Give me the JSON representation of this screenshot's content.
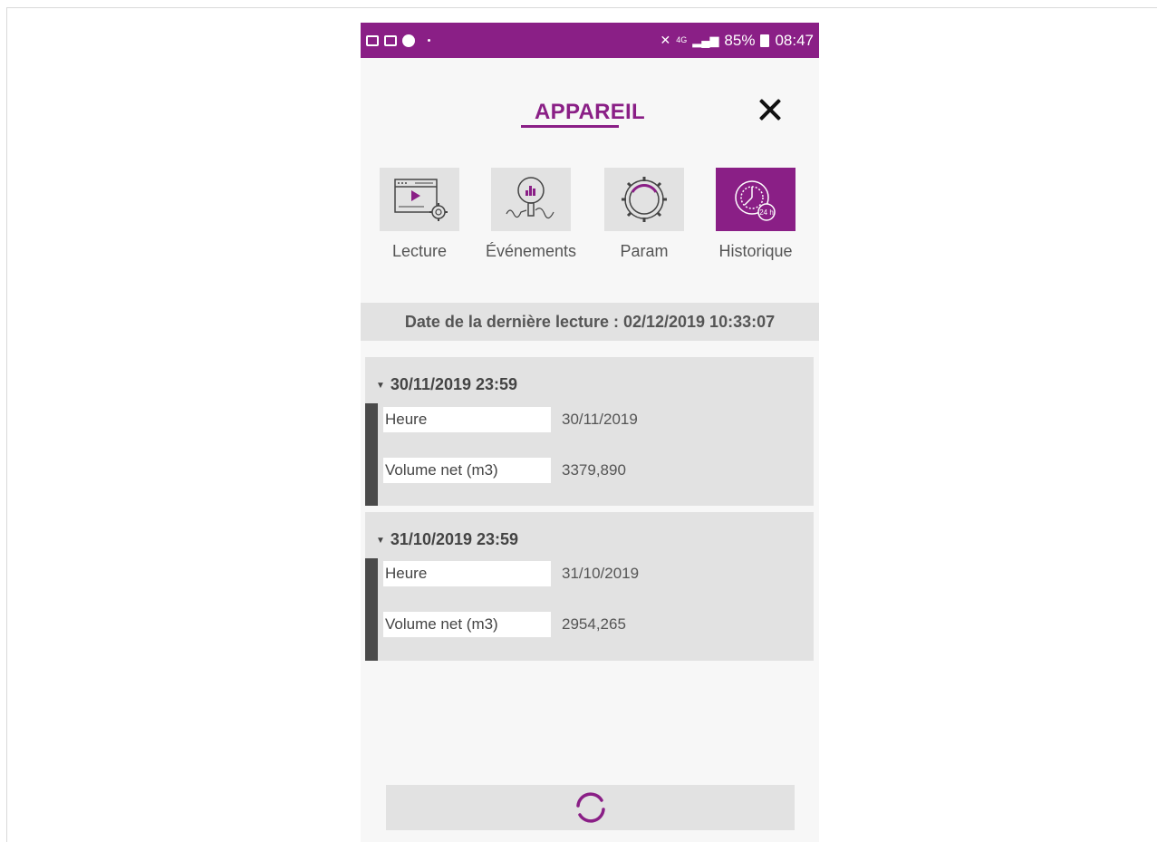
{
  "status_bar": {
    "icons_left": [
      "image-icon",
      "mail-icon",
      "smiley-icon",
      "dot-icon"
    ],
    "network": "4G",
    "battery_percent": "85%",
    "time": "08:47"
  },
  "header": {
    "title": "APPAREIL",
    "close_icon": "close-icon"
  },
  "tabs": [
    {
      "label": "Lecture",
      "icon": "video-settings-icon",
      "active": false
    },
    {
      "label": "Événements",
      "icon": "magnifier-chart-icon",
      "active": false
    },
    {
      "label": "Param",
      "icon": "gear-icon",
      "active": false
    },
    {
      "label": "Historique",
      "icon": "clock-24h-icon",
      "active": true
    }
  ],
  "last_read": "Date de la dernière lecture : 02/12/2019 10:33:07",
  "history": [
    {
      "title": "30/11/2019 23:59",
      "rows": [
        {
          "key": "Heure",
          "value": "30/11/2019"
        },
        {
          "key": "Volume net (m3)",
          "value": "3379,890"
        }
      ]
    },
    {
      "title": "31/10/2019 23:59",
      "rows": [
        {
          "key": "Heure",
          "value": "31/10/2019"
        },
        {
          "key": "Volume net (m3)",
          "value": "2954,265"
        }
      ]
    }
  ],
  "refresh_icon": "refresh-icon",
  "colors": {
    "accent": "#8a1f86",
    "panel": "#e2e2e2",
    "bar": "#4a4a4a"
  }
}
